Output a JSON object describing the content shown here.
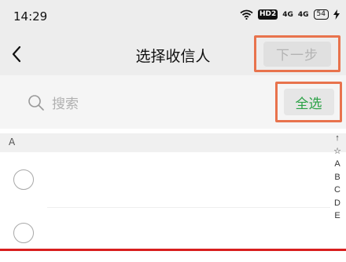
{
  "status_bar": {
    "time": "14:29",
    "hd_label": "HD2",
    "signal_1": "4G",
    "signal_2": "4G",
    "battery": "54"
  },
  "nav": {
    "title": "选择收信人",
    "next_label": "下一步"
  },
  "search": {
    "placeholder": "搜索",
    "select_all_label": "全选"
  },
  "section": {
    "letter": "A"
  },
  "index_bar": [
    "↑",
    "☆",
    "A",
    "B",
    "C",
    "D",
    "E"
  ],
  "colors": {
    "highlight_border": "#e8734d",
    "accent_green": "#2ba246",
    "nav_bg": "#ededed"
  }
}
